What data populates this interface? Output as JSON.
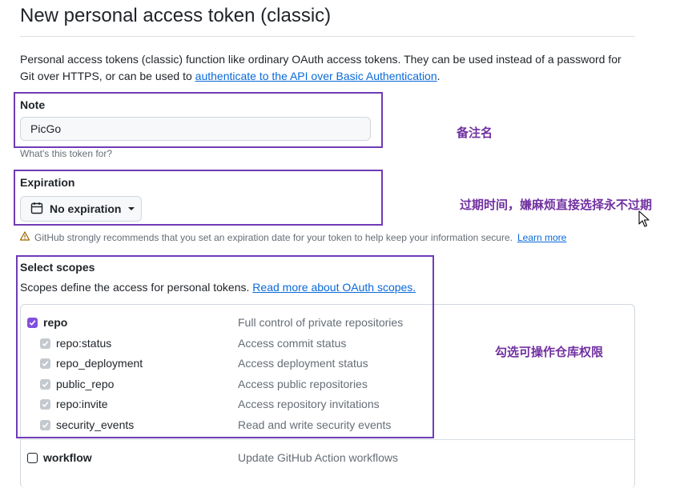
{
  "page": {
    "title": "New personal access token (classic)",
    "description_text": "Personal access tokens (classic) function like ordinary OAuth access tokens. They can be used instead of a password for Git over HTTPS, or can be used to ",
    "description_link": "authenticate to the API over Basic Authentication",
    "description_end": "."
  },
  "note": {
    "label": "Note",
    "value": "PicGo",
    "hint": "What's this token for?"
  },
  "expiration": {
    "label": "Expiration",
    "selected": "No expiration",
    "warning_text": "GitHub strongly recommends that you set an expiration date for your token to help keep your information secure.",
    "warning_link": "Learn more"
  },
  "scopes": {
    "label": "Select scopes",
    "description_text": "Scopes define the access for personal tokens.",
    "description_link": "Read more about OAuth scopes.",
    "items": [
      {
        "name": "repo",
        "desc": "Full control of private repositories",
        "checked": true,
        "parent": true
      },
      {
        "name": "repo:status",
        "desc": "Access commit status",
        "checked": true,
        "parent": false
      },
      {
        "name": "repo_deployment",
        "desc": "Access deployment status",
        "checked": true,
        "parent": false
      },
      {
        "name": "public_repo",
        "desc": "Access public repositories",
        "checked": true,
        "parent": false
      },
      {
        "name": "repo:invite",
        "desc": "Access repository invitations",
        "checked": true,
        "parent": false
      },
      {
        "name": "security_events",
        "desc": "Read and write security events",
        "checked": true,
        "parent": false
      },
      {
        "name": "workflow",
        "desc": "Update GitHub Action workflows",
        "checked": false,
        "parent": true
      }
    ]
  },
  "annotations": {
    "note": "备注名",
    "expiration": "过期时间，嫌麻烦直接选择永不过期",
    "scopes": "勾选可操作仓库权限"
  },
  "colors": {
    "annotation": "#6f3bb5",
    "link": "#0969da",
    "checkbox_checked": "#8250df"
  }
}
